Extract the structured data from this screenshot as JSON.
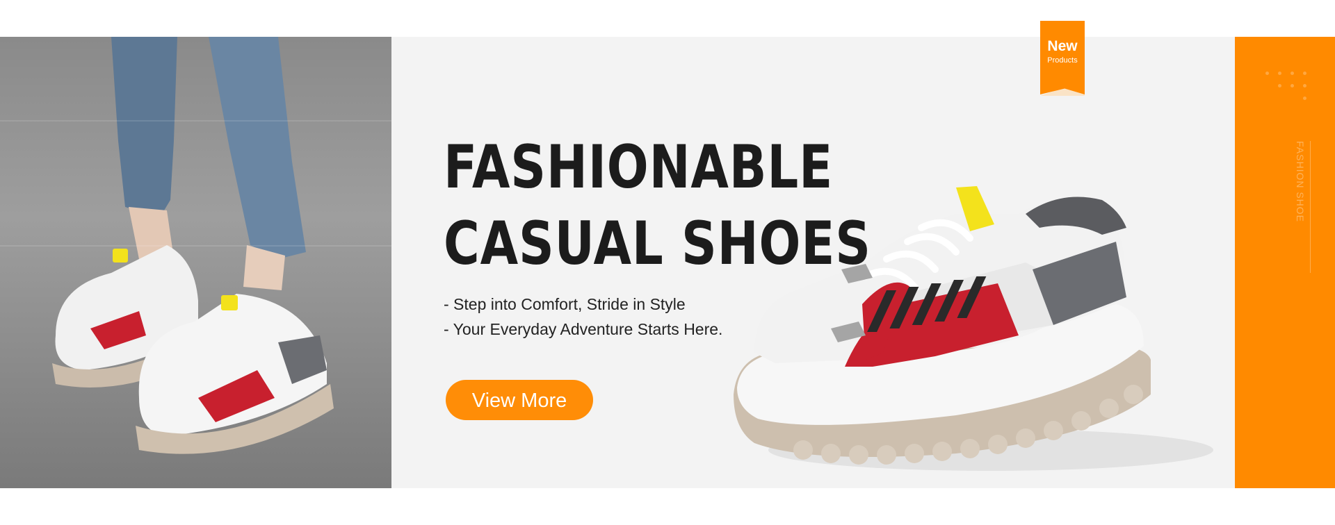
{
  "banner": {
    "headline_line1": "FASHIONABLE",
    "headline_line2": "CASUAL SHOES",
    "tagline_line1": "- Step into Comfort, Stride in Style",
    "tagline_line2": "- Your Everyday Adventure Starts Here.",
    "cta_label": "View More"
  },
  "badge": {
    "title": "New",
    "subtitle": "Products"
  },
  "side_strip": {
    "vertical_text": "FASHION SHOE"
  },
  "colors": {
    "accent": "#ff8a00",
    "banner_bg": "#f3f3f3",
    "headline": "#1c1c1c",
    "shoe_red": "#c8202e",
    "shoe_yellow": "#f3e21c",
    "sole": "#cdbfae"
  },
  "icons": {
    "lifestyle_image": "lifestyle-shoes-photo",
    "product_image": "product-sneaker-image"
  }
}
